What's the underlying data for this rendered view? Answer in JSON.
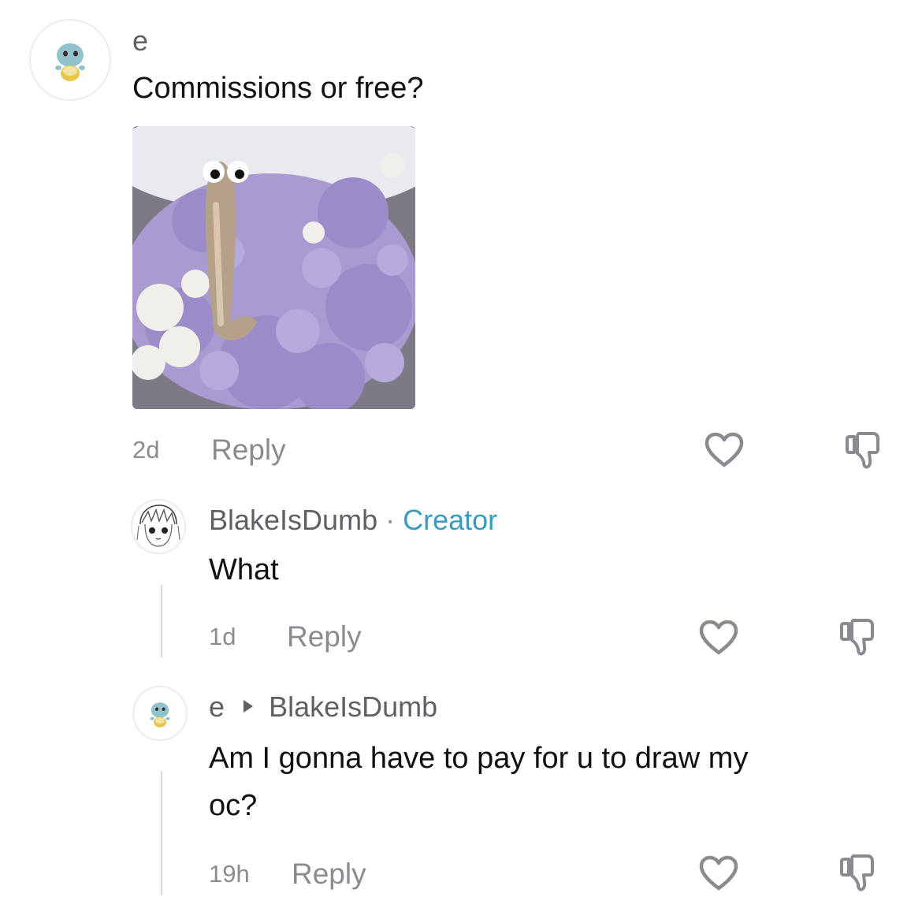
{
  "comments": [
    {
      "username": "e",
      "text": "Commissions or free?",
      "time": "2d",
      "reply_label": "Reply",
      "avatar_icon": "squirtle-avatar-icon"
    },
    {
      "username": "BlakeIsDumb",
      "separator": "·",
      "creator_badge": "Creator",
      "text": "What",
      "time": "1d",
      "reply_label": "Reply",
      "avatar_icon": "anime-sketch-avatar-icon"
    },
    {
      "username": "e",
      "reply_to": "BlakeIsDumb",
      "text_line1": "Am I gonna have to pay for u to draw my",
      "text_line2": "oc?",
      "time": "19h",
      "reply_label": "Reply",
      "avatar_icon": "squirtle-avatar-icon"
    }
  ],
  "icons": {
    "like": "heart-outline-icon",
    "dislike": "thumbs-down-outline-icon",
    "reply_arrow": "right-triangle-icon"
  },
  "colors": {
    "creator_badge": "#3a9bc1",
    "muted_text": "#8a8b91",
    "thread_line": "#d9d9d9"
  }
}
